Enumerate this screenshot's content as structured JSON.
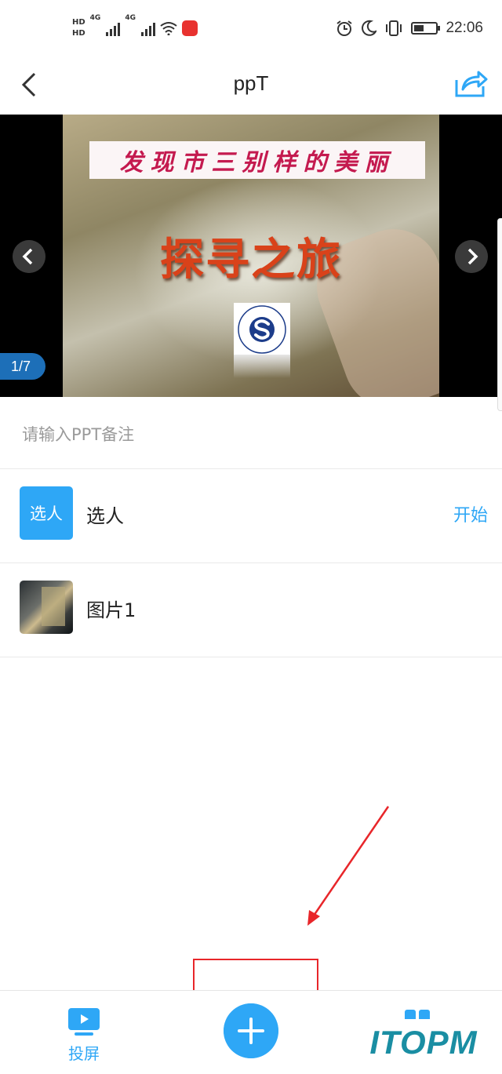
{
  "status_bar": {
    "hd1": "HD",
    "hd2": "HD",
    "network1": "4G",
    "network2": "4G",
    "time": "22:06"
  },
  "header": {
    "title": "ppT"
  },
  "slide": {
    "banner_text": "发现市三别样的美丽",
    "title": "探寻之旅",
    "page_indicator": "1/7"
  },
  "note": {
    "placeholder": "请输入PPT备注"
  },
  "list": {
    "items": [
      {
        "icon_text": "选人",
        "label": "选人",
        "action": "开始"
      },
      {
        "label": "图片1"
      }
    ]
  },
  "bottom_bar": {
    "cast_label": "投屏",
    "watermark": "ITOPM"
  },
  "colors": {
    "accent": "#2ea7f6",
    "annotation": "#e8262a",
    "page_indicator": "#1d6fb8"
  }
}
